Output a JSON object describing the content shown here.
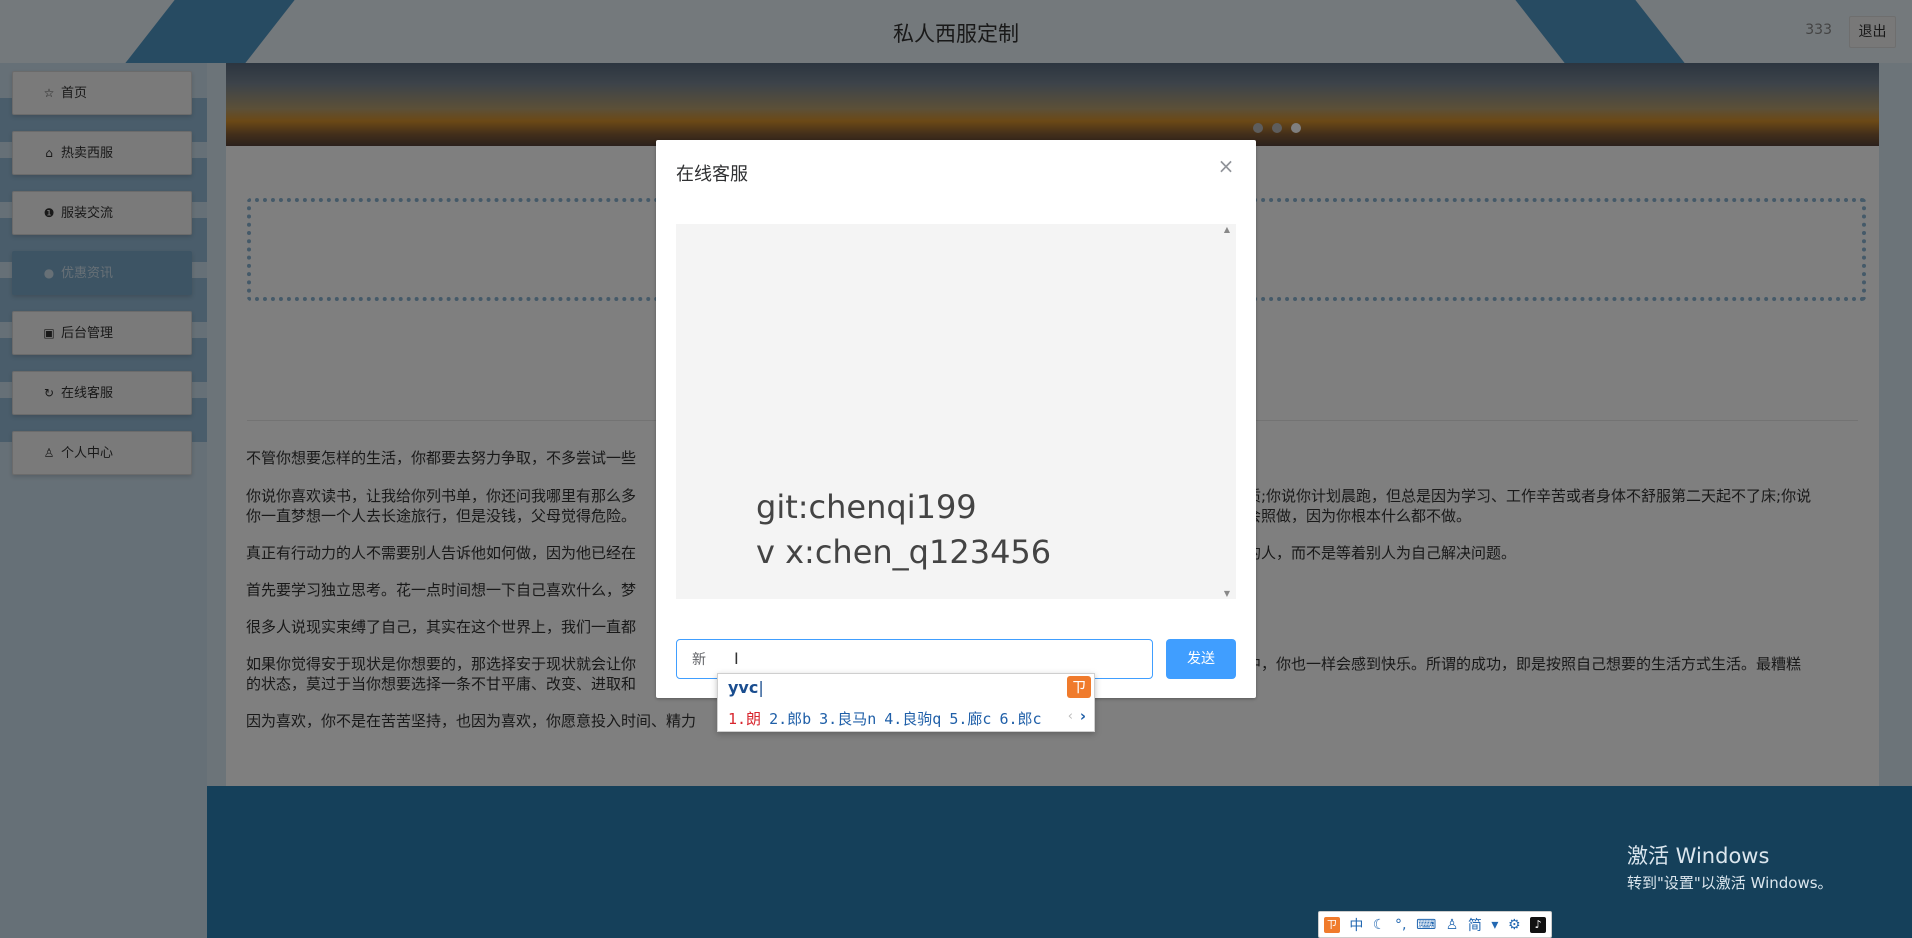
{
  "header": {
    "title": "私人西服定制",
    "username": "333",
    "logout_label": "退出"
  },
  "sidebar": {
    "items": [
      {
        "icon": "☆",
        "label": "首页"
      },
      {
        "icon": "⌂",
        "label": "热卖西服"
      },
      {
        "icon": "❶",
        "label": "服装交流"
      },
      {
        "icon": "●",
        "label": "优惠资讯"
      },
      {
        "icon": "▣",
        "label": "后台管理"
      },
      {
        "icon": "↻",
        "label": "在线客服"
      },
      {
        "icon": "♙",
        "label": "个人中心"
      }
    ]
  },
  "content": {
    "paragraphs": [
      "不管你想要怎样的生活，你都要去努力争取，不多尝试一些",
      "你说你喜欢读书，让我给你列书单，你还问我哪里有那么多",
      "你一直梦想一个人去长途旅行，但是没钱，父母觉得危险。",
      "真正有行动力的人不需要别人告诉他如何做，因为他已经在",
      "首先要学习独立思考。花一点时间想一下自己喜欢什么，梦",
      "很多人说现实束缚了自己，其实在这个世界上，我们一直都",
      "如果你觉得安于现状是你想要的，那选择安于现状就会让你",
      "的状态，莫过于当你想要选择一条不甘平庸、改变、进取和",
      "因为喜欢，你不是在苦苦坚持，也因为喜欢，你愿意投入时间、精力"
    ],
    "paragraphs_right": [
      "质;你说你计划晨跑，但总是因为学习、工作辛苦或者身体不舒服第二天起不了床;你说",
      "会照做，因为你根本什么都不做。",
      "的人，而不是等着别人为自己解决问题。",
      "中，你也一样会感到快乐。所谓的成功，即是按照自己想要的生活方式生活。最糟糕"
    ]
  },
  "dialog": {
    "title": "在线客服",
    "messages": [
      "git:chenqi199",
      "v x:chen_q123456"
    ],
    "input_value": "新",
    "send_label": "发送"
  },
  "ime": {
    "pinyin": "yvc",
    "logo": "ㄗ",
    "candidates": [
      "1.朗",
      "2.郎b",
      "3.良马n",
      "4.良驹q",
      "5.廊c",
      "6.郎c"
    ]
  },
  "ime_toolbar": {
    "mode": "中",
    "simplified": "简"
  },
  "watermark": {
    "line1": "激活 Windows",
    "line2": "转到\"设置\"以激活 Windows。"
  }
}
